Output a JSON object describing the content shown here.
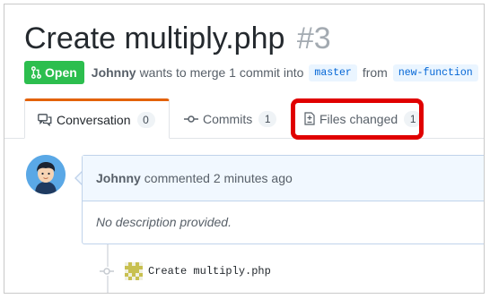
{
  "pr": {
    "title": "Create multiply.php",
    "number": "#3",
    "state": "Open",
    "author": "Johnny",
    "summary_text": "wants to merge 1 commit into",
    "base_branch": "master",
    "from_text": "from",
    "head_branch": "new-function"
  },
  "tabs": [
    {
      "label": "Conversation",
      "count": "0"
    },
    {
      "label": "Commits",
      "count": "1"
    },
    {
      "label": "Files changed",
      "count": "1"
    }
  ],
  "comment": {
    "author": "Johnny",
    "action_text": "commented 2 minutes ago",
    "body": "No description provided."
  },
  "commit": {
    "message": "Create multiply.php"
  },
  "colors": {
    "open_green": "#2cbe4e",
    "highlight_red": "#e00000",
    "branch_blue": "#0366d6"
  }
}
